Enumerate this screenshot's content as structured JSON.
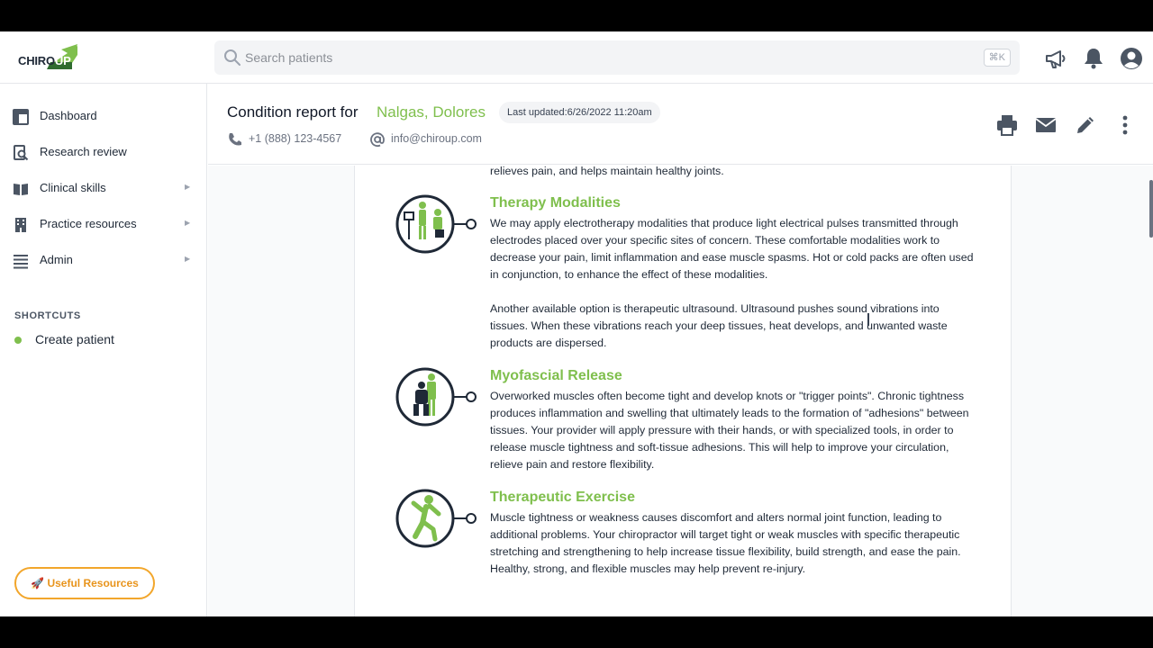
{
  "app": {
    "logo_text": "CHIRO",
    "logo_accent": "UP",
    "brand_green": "#7fbf4d",
    "brand_orange": "#f2a62b"
  },
  "search": {
    "placeholder": "Search patients",
    "shortcut": "⌘K"
  },
  "topbar_icons": [
    "megaphone-icon",
    "bell-icon",
    "user-circle-icon"
  ],
  "sidebar": {
    "items": [
      {
        "label": "Dashboard",
        "icon": "dashboard-icon",
        "has_submenu": false
      },
      {
        "label": "Research review",
        "icon": "research-icon",
        "has_submenu": false
      },
      {
        "label": "Clinical skills",
        "icon": "book-icon",
        "has_submenu": true
      },
      {
        "label": "Practice resources",
        "icon": "building-icon",
        "has_submenu": true
      },
      {
        "label": "Admin",
        "icon": "list-icon",
        "has_submenu": true
      }
    ],
    "caret": "▶",
    "shortcuts_label": "SHORTCUTS",
    "shortcuts": [
      {
        "label": "Create patient"
      }
    ],
    "resources_button": "🚀 Useful Resources"
  },
  "header": {
    "title": "Condition report for",
    "patient_name": "Nalgas, Dolores",
    "last_updated": "Last updated:6/26/2022 11:20am",
    "phone": "+1 (888) 123-4567",
    "email": "info@chiroup.com",
    "actions": [
      "print-icon",
      "mail-icon",
      "pencil-icon",
      "more-vertical-icon"
    ]
  },
  "report": {
    "intro_tail": "relieves pain, and helps maintain healthy joints.",
    "sections": [
      {
        "title": "Therapy Modalities",
        "paragraphs": [
          "We may apply electrotherapy modalities that produce light electrical pulses transmitted through electrodes placed over your specific sites of concern. These comfortable modalities work to decrease your pain, limit inflammation and ease muscle spasms. Hot or cold packs are often used in conjunction, to enhance the effect of these modalities.",
          "Another available option is therapeutic ultrasound. Ultrasound pushes sound vibrations into tissues. When these vibrations reach your deep tissues, heat develops, and unwanted waste products are dispersed."
        ]
      },
      {
        "title": "Myofascial Release",
        "paragraphs": [
          "Overworked muscles often become tight and develop knots or \"trigger points\". Chronic tightness produces inflammation and swelling that ultimately leads to the formation of \"adhesions\" between tissues. Your provider will apply pressure with their hands, or with specialized tools, in order to release muscle tightness and soft-tissue adhesions. This will help to improve your circulation, relieve pain and restore flexibility."
        ]
      },
      {
        "title": "Therapeutic Exercise",
        "paragraphs": [
          "Muscle tightness or weakness causes discomfort and alters normal joint function, leading to additional problems. Your chiropractor will target tight or weak muscles with specific therapeutic stretching and strengthening to help increase tissue flexibility, build strength, and ease the pain. Healthy, strong, and flexible muscles may help prevent re-injury."
        ]
      }
    ]
  }
}
